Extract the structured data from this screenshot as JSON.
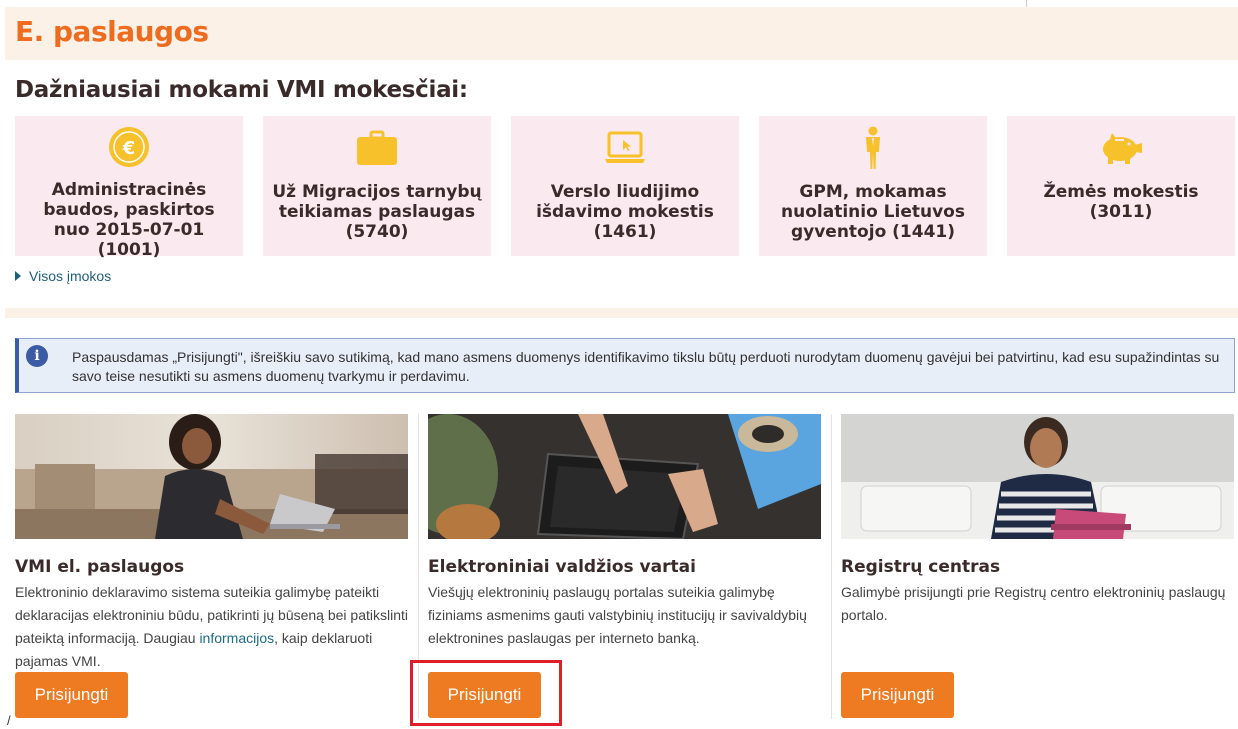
{
  "header": {
    "title": "E. paslaugos"
  },
  "taxes": {
    "title": "Dažniausiai mokami VMI mokesčiai:",
    "items": [
      {
        "label": "Administracinės baudos, paskirtos nuo 2015-07-01 (1001)",
        "icon": "euro-coin-icon"
      },
      {
        "label": "Už Migracijos tarnybų teikiamas paslaugas (5740)",
        "icon": "briefcase-icon"
      },
      {
        "label": "Verslo liudijimo išdavimo mokestis (1461)",
        "icon": "laptop-icon"
      },
      {
        "label": "GPM, mokamas nuolatinio Lietuvos gyventojo (1441)",
        "icon": "person-icon"
      },
      {
        "label": "Žemės mokestis (3011)",
        "icon": "piggy-bank-icon"
      }
    ],
    "all_link": "Visos įmokos"
  },
  "info": {
    "text": "Paspausdamas „Prisijungti\", išreiškiu savo sutikimą, kad mano asmens duomenys identifikavimo tikslu būtų perduoti nurodytam duomenų gavėjui bei patvirtinu, kad esu supažindintas su savo teise nesutikti su asmens duomenų tvarkymu ir perdavimu."
  },
  "services": [
    {
      "title": "VMI el. paslaugos",
      "desc_before": "Elektroninio deklaravimo sistema suteikia galimybę pateikti deklaracijas elektroniniu būdu, patikrinti jų būseną bei patikslinti pateiktą informaciją. Daugiau ",
      "desc_link": "informacijos",
      "desc_after": ", kaip deklaruoti pajamas VMI.",
      "button": "Prisijungti"
    },
    {
      "title": "Elektroniniai valdžios vartai",
      "desc": "Viešųjų elektroninių paslaugų portalas suteikia galimybę fiziniams asmenims gauti valstybinių institucijų ir savivaldybių elektronines paslaugas per interneto banką.",
      "button": "Prisijungti"
    },
    {
      "title": "Registrų centras",
      "desc": "Galimybė prisijungti prie Registrų centro elektroninių paslaugų portalo.",
      "button": "Prisijungti"
    }
  ],
  "colors": {
    "accent_orange": "#ef6b1f",
    "button_orange": "#ee7a22",
    "tile_pink": "#fbe9f0",
    "icon_yellow": "#f6c12a",
    "info_blue": "#3b5ba5",
    "highlight_red": "#e01e2a"
  }
}
